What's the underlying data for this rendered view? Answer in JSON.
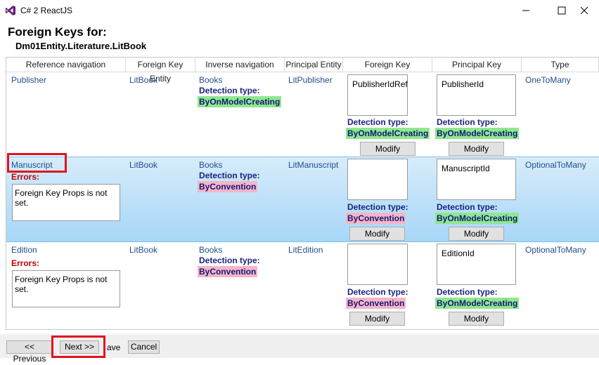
{
  "window": {
    "title": "C# 2 ReactJS"
  },
  "page": {
    "heading": "Foreign Keys for:",
    "entity": "Dm01Entity.Literature.LitBook"
  },
  "columns": [
    "Reference navigation",
    "Foreign Key Entity",
    "Inverse navigation",
    "Principal Entity",
    "Foreign Key",
    "Principal Key",
    "Type"
  ],
  "labels": {
    "detection_type": "Detection type:",
    "errors": "Errors:",
    "modify": "Modify"
  },
  "rows": [
    {
      "ref_nav": "Publisher",
      "fk_entity": "LitBook",
      "inverse_nav": "Books",
      "inverse_detection": "ByOnModelCreating",
      "principal_entity": "LitPublisher",
      "foreign_key": "PublisherIdRef",
      "fk_detection": "ByOnModelCreating",
      "principal_key": "PublisherId",
      "pk_detection": "ByOnModelCreating",
      "type": "OneToMany"
    },
    {
      "ref_nav": "Manuscript",
      "error_text": "Foreign Key Props is not set.",
      "fk_entity": "LitBook",
      "inverse_nav": "Books",
      "inverse_detection": "ByConvention",
      "principal_entity": "LitManuscript",
      "foreign_key": "",
      "fk_detection": "ByConvention",
      "principal_key": "ManuscriptId",
      "pk_detection": "ByOnModelCreating",
      "type": "OptionalToMany"
    },
    {
      "ref_nav": "Edition",
      "error_text": "Foreign Key Props is not set.",
      "fk_entity": "LitBook",
      "inverse_nav": "Books",
      "inverse_detection": "ByConvention",
      "principal_entity": "LitEdition",
      "foreign_key": "",
      "fk_detection": "ByConvention",
      "principal_key": "EditionId",
      "pk_detection": "ByOnModelCreating",
      "type": "OptionalToMany"
    }
  ],
  "footer": {
    "previous": "<< Previous",
    "next": "Next >>",
    "save_fragment": "ave",
    "cancel": "Cancel"
  },
  "colors": {
    "accent_red": "#e0141e",
    "detection_green": "#8ee88e",
    "detection_pink": "#f4b6c6",
    "selected_row": "#a6d7f7"
  }
}
